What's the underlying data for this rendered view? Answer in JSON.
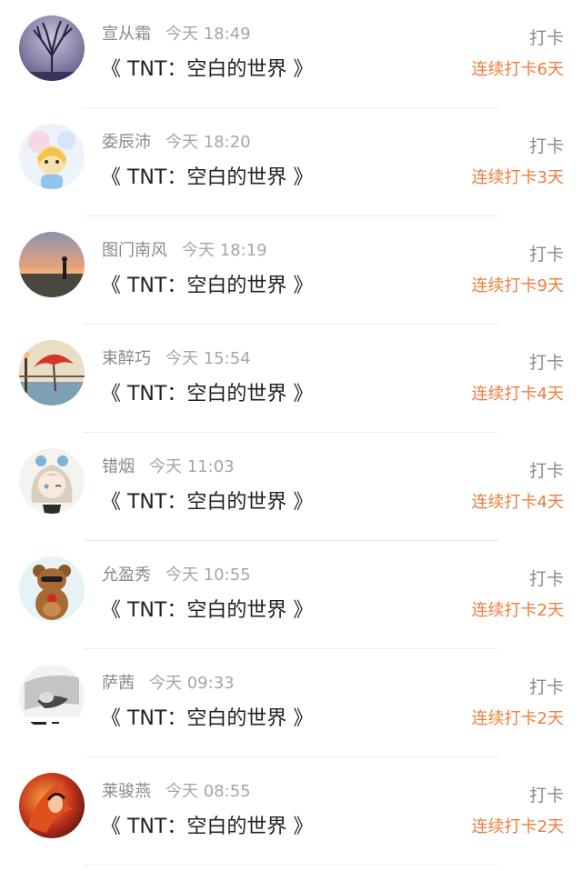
{
  "colors": {
    "accent": "#f07c3c",
    "muted": "#8a8a8a",
    "text": "#222222"
  },
  "records": [
    {
      "name": "宣从霜",
      "time": "今天 18:49",
      "title": "《 TNT：空白的世界 》",
      "action": "打卡",
      "streak": "连续打卡6天",
      "avatar": "tree-night-avatar"
    },
    {
      "name": "委辰沛",
      "time": "今天 18:20",
      "title": "《 TNT：空白的世界 》",
      "action": "打卡",
      "streak": "连续打卡3天",
      "avatar": "cartoon-girl-avatar"
    },
    {
      "name": "图门南风",
      "time": "今天 18:19",
      "title": "《 TNT：空白的世界 》",
      "action": "打卡",
      "streak": "连续打卡9天",
      "avatar": "sunset-silhouette-avatar"
    },
    {
      "name": "束醉巧",
      "time": "今天 15:54",
      "title": "《 TNT：空白的世界 》",
      "action": "打卡",
      "streak": "连续打卡4天",
      "avatar": "red-umbrella-avatar"
    },
    {
      "name": "错烟",
      "time": "今天 11:03",
      "title": "《 TNT：空白的世界 》",
      "action": "打卡",
      "streak": "连续打卡4天",
      "avatar": "anime-girl-avatar"
    },
    {
      "name": "允盈秀",
      "time": "今天 10:55",
      "title": "《 TNT：空白的世界 》",
      "action": "打卡",
      "streak": "连续打卡2天",
      "avatar": "bear-avatar"
    },
    {
      "name": "萨茜",
      "time": "今天 09:33",
      "title": "《 TNT：空白的世界 》",
      "action": "打卡",
      "streak": "连续打卡2天",
      "avatar": "bw-photo-avatar"
    },
    {
      "name": "莱骏燕",
      "time": "今天 08:55",
      "title": "《 TNT：空白的世界 》",
      "action": "打卡",
      "streak": "连续打卡2天",
      "avatar": "fire-hair-avatar"
    }
  ]
}
